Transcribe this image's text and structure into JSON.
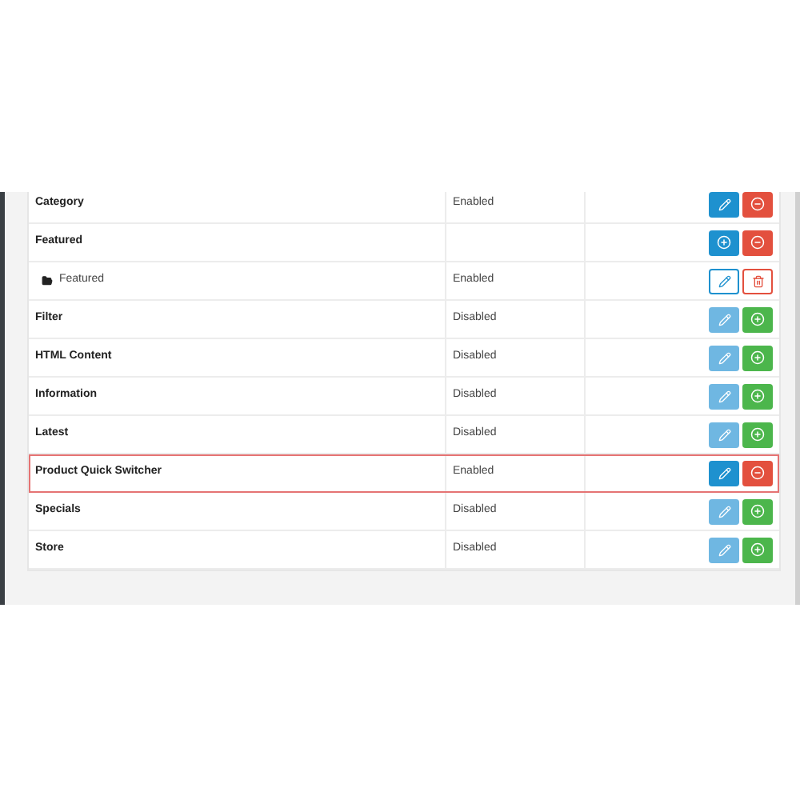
{
  "modules": [
    {
      "name": "Category",
      "status": "Enabled",
      "kind": "module",
      "installed": true,
      "highlighted": false
    },
    {
      "name": "Featured",
      "kind": "group",
      "installed": true,
      "highlighted": false
    },
    {
      "name": "Featured",
      "status": "Enabled",
      "kind": "instance",
      "installed": true,
      "highlighted": false
    },
    {
      "name": "Filter",
      "status": "Disabled",
      "kind": "module",
      "installed": false,
      "highlighted": false
    },
    {
      "name": "HTML Content",
      "status": "Disabled",
      "kind": "module",
      "installed": false,
      "highlighted": false
    },
    {
      "name": "Information",
      "status": "Disabled",
      "kind": "module",
      "installed": false,
      "highlighted": false
    },
    {
      "name": "Latest",
      "status": "Disabled",
      "kind": "module",
      "installed": false,
      "highlighted": false
    },
    {
      "name": "Product Quick Switcher",
      "status": "Enabled",
      "kind": "module",
      "installed": true,
      "highlighted": true
    },
    {
      "name": "Specials",
      "status": "Disabled",
      "kind": "module",
      "installed": false,
      "highlighted": false
    },
    {
      "name": "Store",
      "status": "Disabled",
      "kind": "module",
      "installed": false,
      "highlighted": false
    }
  ]
}
